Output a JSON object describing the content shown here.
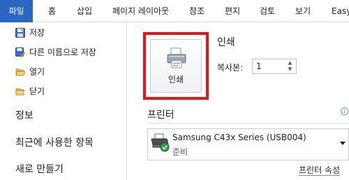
{
  "ribbon": {
    "tabs": [
      {
        "label": "파일"
      },
      {
        "label": "홈"
      },
      {
        "label": "삽입"
      },
      {
        "label": "페이지 레이아웃"
      },
      {
        "label": "참조"
      },
      {
        "label": "편지"
      },
      {
        "label": "검토"
      },
      {
        "label": "보기"
      },
      {
        "label": "Easy"
      }
    ],
    "active_color": "#2a66c3"
  },
  "nav": {
    "items": [
      {
        "label": "저장",
        "icon": "floppy-disk-icon"
      },
      {
        "label": "다른 이름으로 저장",
        "icon": "save-as-icon"
      },
      {
        "label": "열기",
        "icon": "open-folder-icon"
      },
      {
        "label": "닫기",
        "icon": "close-folder-icon"
      }
    ],
    "sections": [
      {
        "label": "정보"
      },
      {
        "label": "최근에 사용한 항목"
      },
      {
        "label": "새로 만들기"
      }
    ]
  },
  "print": {
    "heading": "인쇄",
    "button_label": "인쇄",
    "copies_label": "복사본:",
    "copies_value": "1",
    "highlight_color": "#e8141c"
  },
  "printer": {
    "heading": "프린터",
    "name": "Samsung C43x Series (USB004)",
    "status": "준비",
    "properties_link": "프린터 속성"
  }
}
